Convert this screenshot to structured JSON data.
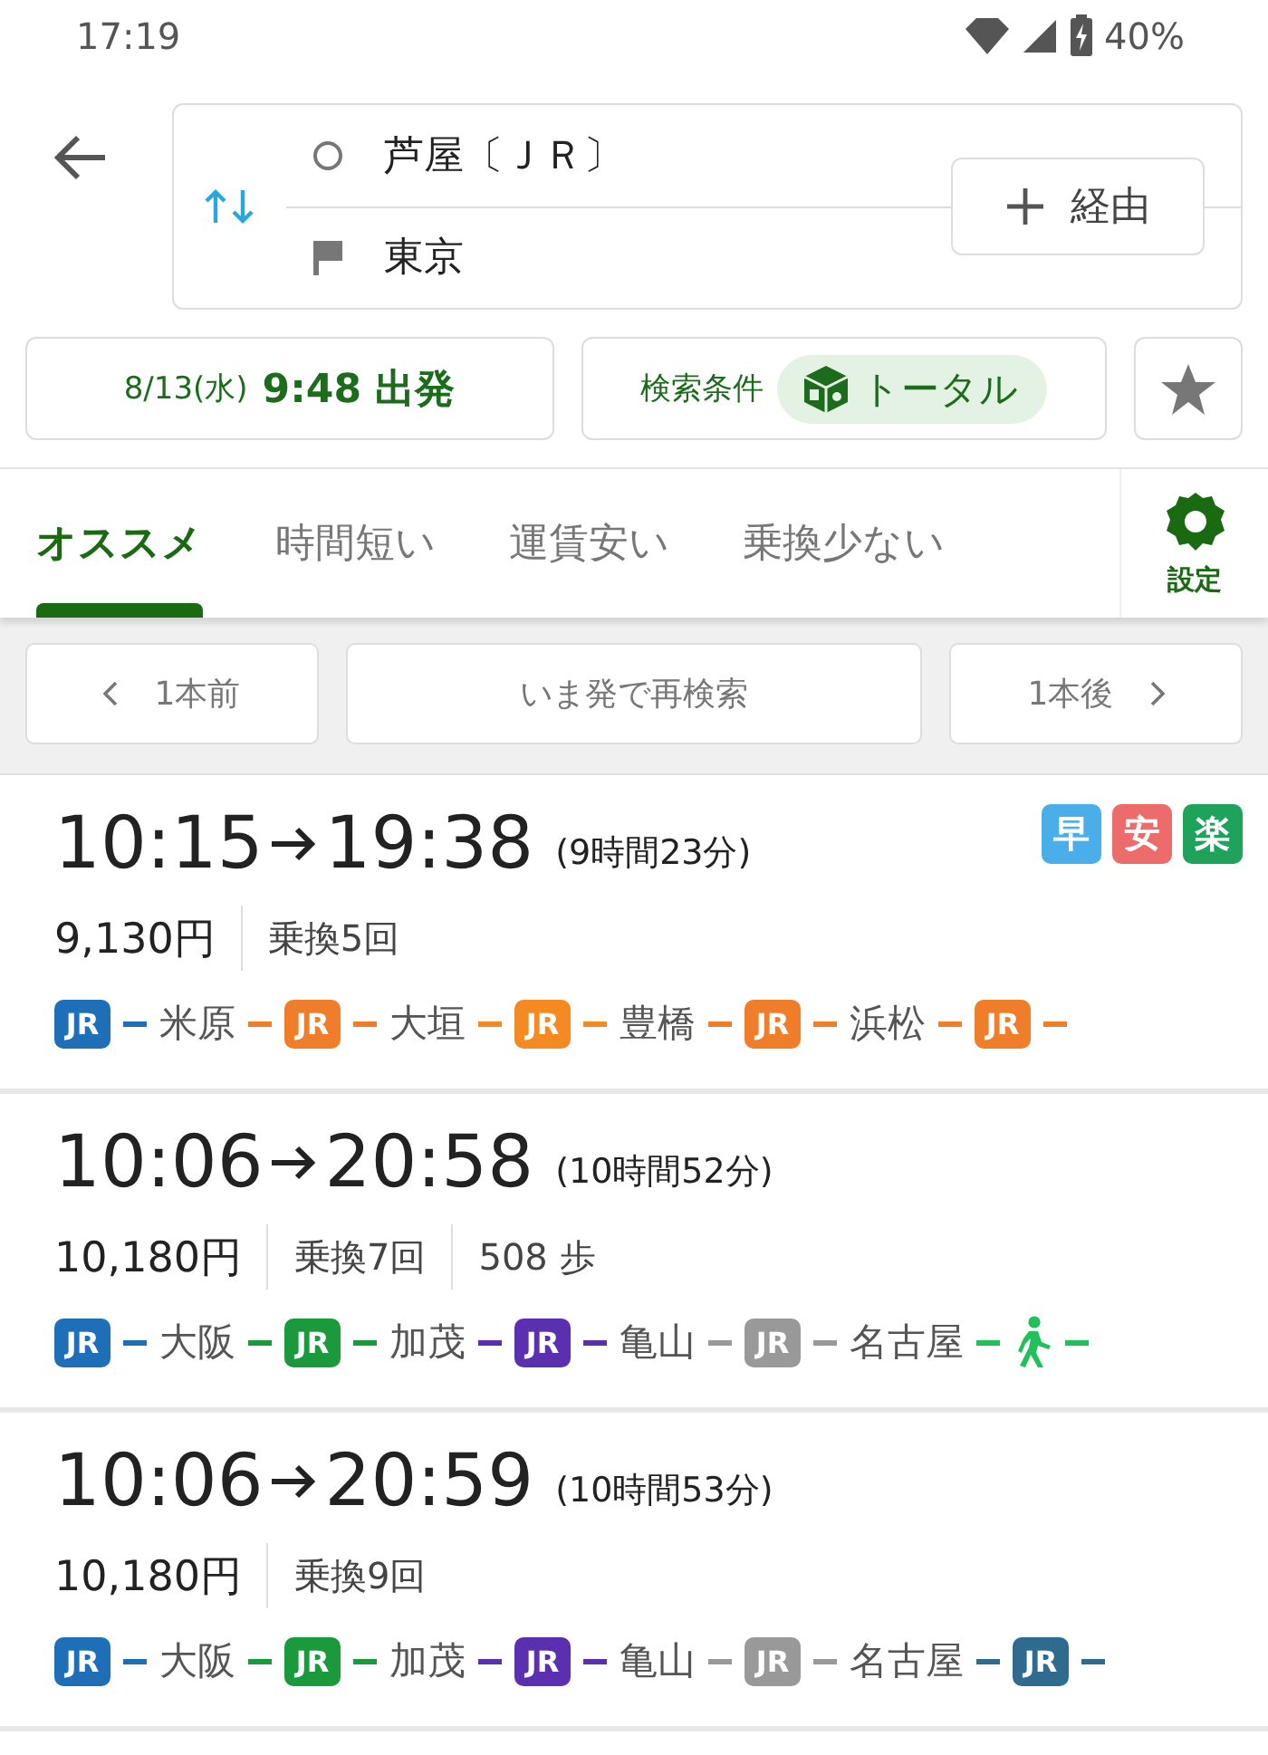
{
  "status_bar": {
    "time": "17:19",
    "battery": "40%"
  },
  "search": {
    "from": "芦屋〔ＪＲ〕",
    "to": "東京",
    "via_button": "経由"
  },
  "options": {
    "date": "8/13(水)",
    "time": "9:48 出発",
    "conditions_label": "検索条件",
    "conditions_value": "トータル"
  },
  "tabs": [
    {
      "label": "オススメ",
      "selected": true
    },
    {
      "label": "時間短い",
      "selected": false
    },
    {
      "label": "運賃安い",
      "selected": false
    },
    {
      "label": "乗換少ない",
      "selected": false
    }
  ],
  "settings": {
    "label": "設定"
  },
  "nav": {
    "previous": "1本前",
    "research": "いま発で再検索",
    "next": "1本後"
  },
  "routes": [
    {
      "depart": "10:15",
      "arrive": "19:38",
      "duration": "(9時間23分)",
      "fare": "9,130円",
      "transfers": "乗換5回",
      "tags": [
        {
          "label": "早",
          "color": "#4aaee8"
        },
        {
          "label": "安",
          "color": "#ec6b6b"
        },
        {
          "label": "楽",
          "color": "#1fa35a"
        }
      ],
      "segments": [
        {
          "kind": "line",
          "label": "JR",
          "color": "#1e6fb8"
        },
        {
          "kind": "station",
          "name": "米原"
        },
        {
          "kind": "line",
          "label": "JR",
          "color": "#f07d2a"
        },
        {
          "kind": "station",
          "name": "大垣"
        },
        {
          "kind": "line",
          "label": "JR",
          "color": "#f58a22"
        },
        {
          "kind": "station",
          "name": "豊橋"
        },
        {
          "kind": "line",
          "label": "JR",
          "color": "#f07d2a"
        },
        {
          "kind": "station",
          "name": "浜松"
        },
        {
          "kind": "line",
          "label": "JR",
          "color": "#f07d2a"
        }
      ]
    },
    {
      "depart": "10:06",
      "arrive": "20:58",
      "duration": "(10時間52分)",
      "fare": "10,180円",
      "transfers": "乗換7回",
      "steps": "508 歩",
      "segments": [
        {
          "kind": "line",
          "label": "JR",
          "color": "#1e6fb8"
        },
        {
          "kind": "station",
          "name": "大阪"
        },
        {
          "kind": "line",
          "label": "JR",
          "color": "#1a9a3c"
        },
        {
          "kind": "station",
          "name": "加茂"
        },
        {
          "kind": "line",
          "label": "JR",
          "color": "#5a2fb0"
        },
        {
          "kind": "station",
          "name": "亀山"
        },
        {
          "kind": "line",
          "label": "JR",
          "color": "#999999"
        },
        {
          "kind": "station",
          "name": "名古屋"
        },
        {
          "kind": "walk",
          "color": "#22c05a"
        }
      ]
    },
    {
      "depart": "10:06",
      "arrive": "20:59",
      "duration": "(10時間53分)",
      "fare": "10,180円",
      "transfers": "乗換9回",
      "segments": [
        {
          "kind": "line",
          "label": "JR",
          "color": "#1e6fb8"
        },
        {
          "kind": "station",
          "name": "大阪"
        },
        {
          "kind": "line",
          "label": "JR",
          "color": "#1a9a3c"
        },
        {
          "kind": "station",
          "name": "加茂"
        },
        {
          "kind": "line",
          "label": "JR",
          "color": "#5a2fb0"
        },
        {
          "kind": "station",
          "name": "亀山"
        },
        {
          "kind": "line",
          "label": "JR",
          "color": "#999999"
        },
        {
          "kind": "station",
          "name": "名古屋"
        },
        {
          "kind": "line",
          "label": "JR",
          "color": "#2f6b8f"
        }
      ]
    }
  ]
}
